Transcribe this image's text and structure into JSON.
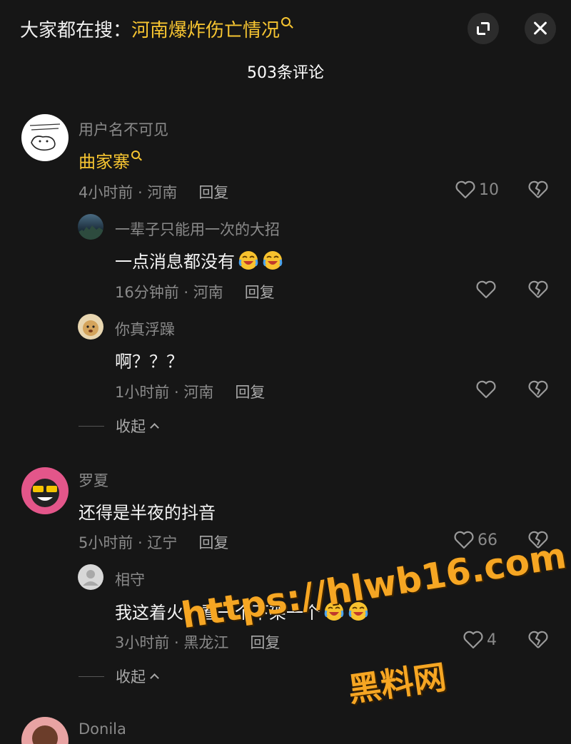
{
  "header": {
    "search_prefix": "大家都在搜：",
    "search_keyword": "河南爆炸伤亡情况",
    "comment_count": "503条评论"
  },
  "comments": [
    {
      "user": "用户名不可见",
      "text": "曲家寨",
      "time_loc": "4小时前 · 河南",
      "reply": "回复",
      "likes": "10",
      "replies": [
        {
          "user": "一辈子只能用一次的大招",
          "text": "一点消息都没有",
          "time_loc": "16分钟前 · 河南",
          "reply": "回复"
        },
        {
          "user": "你真浮躁",
          "text": "啊？？？",
          "time_loc": "1小时前 · 河南",
          "reply": "回复"
        }
      ],
      "collapse": "收起"
    },
    {
      "user": "罗夏",
      "text": "还得是半夜的抖音",
      "time_loc": "5小时前 · 辽宁",
      "reply": "回复",
      "likes": "66",
      "replies": [
        {
          "user": "相守",
          "text": "我这着火，看一个下架一个",
          "time_loc": "3小时前 · 黑龙江",
          "reply": "回复",
          "likes": "4"
        }
      ],
      "collapse": "收起"
    },
    {
      "user": "Donila"
    }
  ],
  "watermark": {
    "url": "https://hlwb16.com",
    "name": "黑料网"
  },
  "colors": {
    "background": "#161616",
    "keyword": "#f7c531",
    "watermark": "#f6a623",
    "muted_text": "#8a8a8a"
  }
}
